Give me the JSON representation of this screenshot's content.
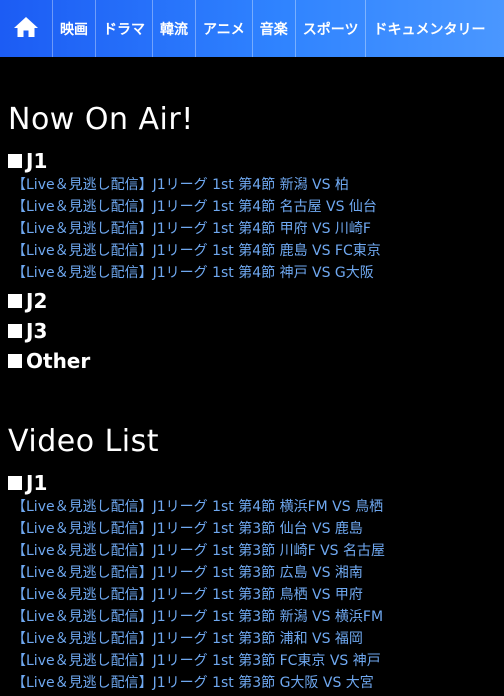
{
  "nav": {
    "home_icon": "home-icon",
    "items": [
      {
        "label": "映画"
      },
      {
        "label": "ドラマ"
      },
      {
        "label": "韓流"
      },
      {
        "label": "アニメ"
      },
      {
        "label": "音楽"
      },
      {
        "label": "スポーツ"
      },
      {
        "label": "ドキュメンタリー"
      }
    ]
  },
  "now_on_air": {
    "title": "Now On Air!",
    "categories": [
      {
        "label": "J1",
        "links": [
          "【Live＆見逃し配信】J1リーグ 1st 第4節 新潟 VS 柏",
          "【Live＆見逃し配信】J1リーグ 1st 第4節 名古屋 VS 仙台",
          "【Live＆見逃し配信】J1リーグ 1st 第4節 甲府 VS 川崎F",
          "【Live＆見逃し配信】J1リーグ 1st 第4節 鹿島 VS FC東京",
          "【Live＆見逃し配信】J1リーグ 1st 第4節 神戸 VS G大阪"
        ]
      },
      {
        "label": "J2"
      },
      {
        "label": "J3"
      },
      {
        "label": "Other"
      }
    ]
  },
  "video_list": {
    "title": "Video List",
    "categories": [
      {
        "label": "J1",
        "links": [
          "【Live＆見逃し配信】J1リーグ 1st 第4節 横浜FM VS 鳥栖",
          "【Live＆見逃し配信】J1リーグ 1st 第3節 仙台 VS 鹿島",
          "【Live＆見逃し配信】J1リーグ 1st 第3節 川崎F VS 名古屋",
          "【Live＆見逃し配信】J1リーグ 1st 第3節 広島 VS 湘南",
          "【Live＆見逃し配信】J1リーグ 1st 第3節 鳥栖 VS 甲府",
          "【Live＆見逃し配信】J1リーグ 1st 第3節 新潟 VS 横浜FM",
          "【Live＆見逃し配信】J1リーグ 1st 第3節 浦和 VS 福岡",
          "【Live＆見逃し配信】J1リーグ 1st 第3節 FC東京 VS 神戸",
          "【Live＆見逃し配信】J1リーグ 1st 第3節 G大阪 VS 大宮"
        ]
      }
    ]
  },
  "colors": {
    "background": "#000000",
    "link": "#6fa8f0",
    "nav_gradient_start": "#1c5cf4",
    "nav_gradient_end": "#4a97ff"
  }
}
